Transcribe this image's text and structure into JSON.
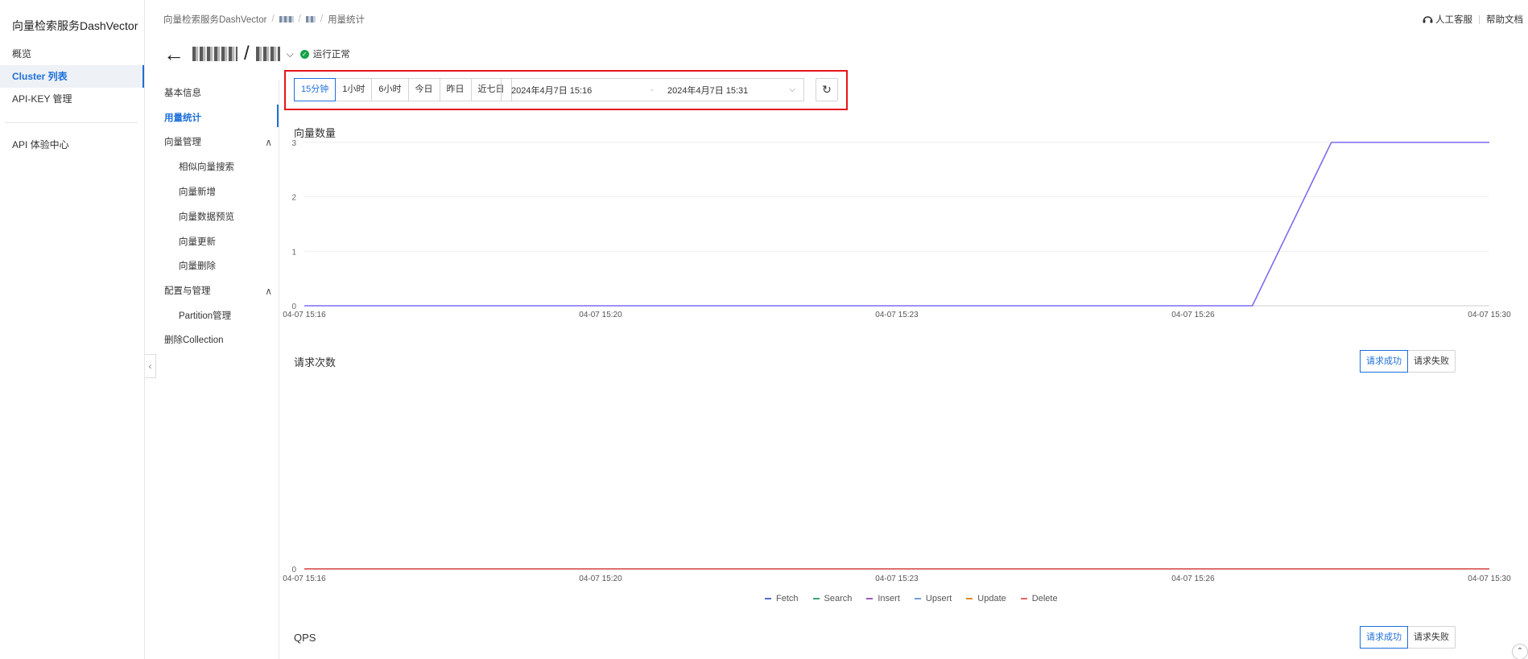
{
  "sidebar": {
    "brand": "向量检索服务DashVector",
    "items": [
      {
        "label": "概览"
      },
      {
        "label": "Cluster 列表"
      },
      {
        "label": "API-KEY 管理"
      },
      {
        "label": "API 体验中心"
      }
    ],
    "collapse_glyph": "‹"
  },
  "header": {
    "breadcrumb": {
      "root": "向量检索服务DashVector",
      "sep": "/",
      "current": "用量统计"
    },
    "links": {
      "support": "人工客服",
      "docs": "帮助文档"
    },
    "title_separator": "/",
    "status_text": "运行正常"
  },
  "subnav": {
    "items": [
      {
        "label": "基本信息"
      },
      {
        "label": "用量统计"
      },
      {
        "label": "向量管理",
        "caret": "∧"
      },
      {
        "label": "相似向量搜索"
      },
      {
        "label": "向量新增"
      },
      {
        "label": "向量数据预览"
      },
      {
        "label": "向量更新"
      },
      {
        "label": "向量删除"
      },
      {
        "label": "配置与管理",
        "caret": "∧"
      },
      {
        "label": "Partition管理"
      },
      {
        "label": "删除Collection"
      }
    ]
  },
  "filter": {
    "ranges": [
      "15分钟",
      "1小时",
      "6小时",
      "今日",
      "昨日",
      "近七日"
    ],
    "selected_range": "15分钟",
    "date_start": "2024年4月7日 15:16",
    "date_sep": "-",
    "date_end": "2024年4月7日 15:31",
    "refresh_glyph": "↻"
  },
  "charts": {
    "toggle": {
      "success": "请求成功",
      "fail": "请求失败"
    }
  },
  "colors": {
    "accent": "#1e6fd9",
    "highlight": "#e5141a",
    "vector_line": "#7b6cf0",
    "status_ok": "#15a34a"
  },
  "chart_data": [
    {
      "type": "line",
      "title": "向量数量",
      "categories": [
        "04-07 15:16",
        "04-07 15:20",
        "04-07 15:23",
        "04-07 15:26",
        "04-07 15:30"
      ],
      "x": [
        "15:16",
        "15:17",
        "15:18",
        "15:19",
        "15:20",
        "15:21",
        "15:22",
        "15:23",
        "15:24",
        "15:25",
        "15:26",
        "15:27",
        "15:28",
        "15:29",
        "15:30"
      ],
      "series": [
        {
          "values": [
            0,
            0,
            0,
            0,
            0,
            0,
            0,
            0,
            0,
            0,
            0,
            0,
            0,
            3,
            3,
            3
          ]
        }
      ],
      "yticks": [
        "0",
        "1",
        "2",
        "3"
      ],
      "ylim": [
        0,
        3
      ],
      "grid": true
    },
    {
      "type": "line",
      "title": "请求次数",
      "categories": [
        "04-07 15:16",
        "04-07 15:20",
        "04-07 15:23",
        "04-07 15:26",
        "04-07 15:30"
      ],
      "yticks": [
        "0"
      ],
      "ylim": [
        0,
        1
      ],
      "legend_position": "bottom",
      "series": [
        {
          "name": "Fetch",
          "color": "#5470c6",
          "values": [
            0,
            0
          ]
        },
        {
          "name": "Search",
          "color": "#3ba272",
          "values": [
            0,
            0
          ]
        },
        {
          "name": "Insert",
          "color": "#9a60b4",
          "values": [
            0,
            0
          ]
        },
        {
          "name": "Upsert",
          "color": "#73a0d6",
          "values": [
            0,
            0
          ]
        },
        {
          "name": "Update",
          "color": "#e08a2e",
          "values": [
            0,
            0
          ]
        },
        {
          "name": "Delete",
          "color": "#ee6666",
          "values": [
            0,
            0
          ]
        }
      ]
    },
    {
      "type": "line",
      "title": "QPS"
    }
  ]
}
